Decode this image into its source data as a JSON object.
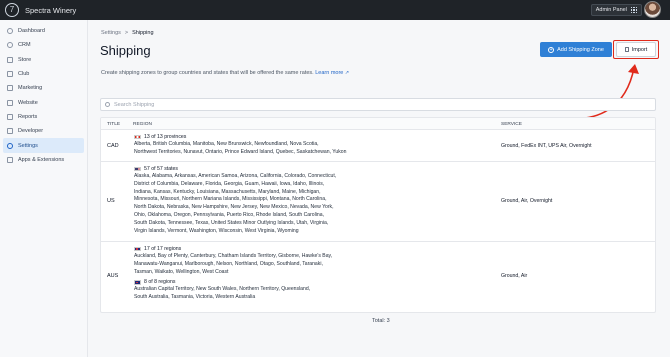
{
  "app": {
    "name": "Spectra Winery",
    "logo_glyph": "7"
  },
  "topbar": {
    "admin_panel_label": "Admin Panel"
  },
  "sidebar": {
    "items": [
      {
        "label": "Dashboard",
        "icon": "dashboard-icon"
      },
      {
        "label": "CRM",
        "icon": "crm-icon"
      },
      {
        "label": "Store",
        "icon": "store-icon"
      },
      {
        "label": "Club",
        "icon": "club-icon"
      },
      {
        "label": "Marketing",
        "icon": "marketing-icon"
      },
      {
        "label": "Website",
        "icon": "website-icon"
      },
      {
        "label": "Reports",
        "icon": "reports-icon"
      },
      {
        "label": "Developer",
        "icon": "developer-icon"
      },
      {
        "label": "Settings",
        "icon": "settings-icon",
        "active": true
      },
      {
        "label": "Apps & Extensions",
        "icon": "apps-icon"
      }
    ]
  },
  "breadcrumb": {
    "parent": "Settings",
    "separator": ">",
    "current": "Shipping"
  },
  "page": {
    "title": "Shipping",
    "description": "Create shipping zones to group countries and states that will be offered the same rates.",
    "learn_more": "Learn more",
    "add_zone_label": "Add Shipping Zone",
    "import_label": "Import",
    "search_placeholder": "Search Shipping"
  },
  "table": {
    "headers": {
      "title": "TITLE",
      "region": "REGION",
      "service": "SERVICE"
    },
    "rows": [
      {
        "title": "CAD",
        "regions": [
          {
            "count": "13 of 13 provinces",
            "lines": [
              "Alberta, British Columbia, Manitoba, New Brunswick, Newfoundland, Nova Scotia,",
              "Northwest Territories, Nunavut, Ontario, Prince Edward Island, Quebec, Saskatchewan, Yukon"
            ]
          }
        ],
        "service": "Ground, FedEx INT, UPS Air, Overnight"
      },
      {
        "title": "US",
        "regions": [
          {
            "count": "57 of 57 states",
            "lines": [
              "Alaska, Alabama, Arkansas, American Samoa, Arizona, California, Colorado, Connecticut,",
              "District of Columbia, Delaware, Florida, Georgia, Guam, Hawaii, Iowa, Idaho, Illinois,",
              "Indiana, Kansas, Kentucky, Louisiana, Massachusetts, Maryland, Maine, Michigan,",
              "Minnesota, Missouri, Northern Mariana Islands, Mississippi, Montana, North Carolina,",
              "North Dakota, Nebraska, New Hampshire, New Jersey, New Mexico, Nevada, New York,",
              "Ohio, Oklahoma, Oregon, Pennsylvania, Puerto Rico, Rhode Island, South Carolina,",
              "South Dakota, Tennessee, Texas, United States Minor Outlying Islands, Utah, Virginia,",
              "Virgin Islands, Vermont, Washington, Wisconsin, West Virginia, Wyoming"
            ]
          }
        ],
        "service": "Ground, Air, Overnight"
      },
      {
        "title": "AUS",
        "regions": [
          {
            "count": "17 of 17 regions",
            "lines": [
              "Auckland, Bay of Plenty, Canterbury, Chatham Islands Territory, Gisborne, Hawke's Bay,",
              "Manawatu-Wanganui, Marlborough, Nelson, Northland, Otago, Southland, Taranaki,",
              "Tasman, Waikato, Wellington, West Coast"
            ]
          },
          {
            "count": "8 of 8 regions",
            "lines": [
              "Australian Capital Territory, New South Wales, Northern Territory, Queensland,",
              "South Australia, Tasmania, Victoria, Western Australia"
            ]
          }
        ],
        "service": "Ground, Air"
      }
    ],
    "total": "Total: 3"
  },
  "colors": {
    "accent": "#2f80d6",
    "highlight_frame": "#e02a1b",
    "topbar": "#1f2328"
  }
}
